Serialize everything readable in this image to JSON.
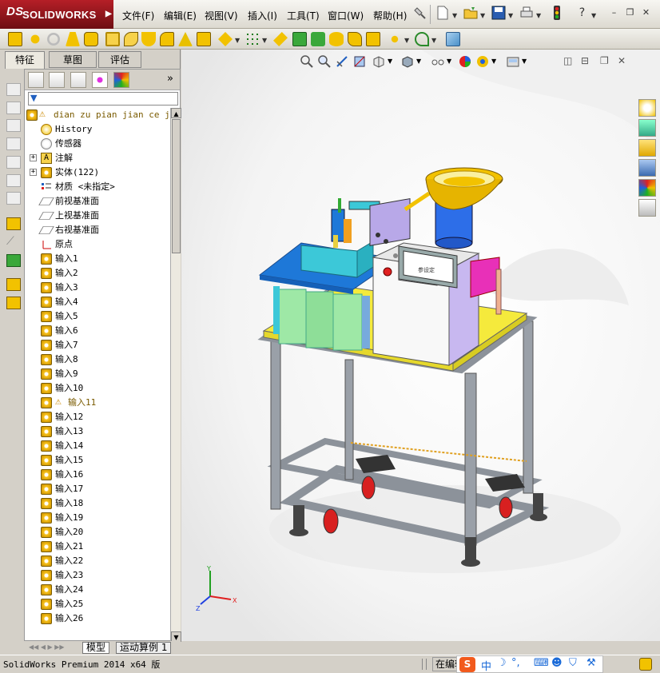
{
  "app": {
    "brand": "SOLIDWORKS",
    "brand_prefix": "DS",
    "status_text": "SolidWorks Premium 2014 x64 版",
    "status_mode": "在编辑"
  },
  "menu": [
    {
      "label": "文件(F)"
    },
    {
      "label": "编辑(E)"
    },
    {
      "label": "视图(V)"
    },
    {
      "label": "插入(I)"
    },
    {
      "label": "工具(T)"
    },
    {
      "label": "窗口(W)"
    },
    {
      "label": "帮助(H)"
    }
  ],
  "window_buttons": {
    "help": "?",
    "minimize": "–",
    "restore": "❐",
    "close": "✕"
  },
  "manager_tabs": [
    {
      "label": "特征",
      "active": true
    },
    {
      "label": "草图",
      "active": false
    },
    {
      "label": "评估",
      "active": false
    }
  ],
  "tree": {
    "root": "dian zu pian jian ce ji",
    "items": [
      {
        "label": "History",
        "icon": "history-icon"
      },
      {
        "label": "传感器",
        "icon": "sensor-icon"
      },
      {
        "label": "注解",
        "icon": "annotation-icon",
        "expandable": true
      },
      {
        "label": "实体(122)",
        "icon": "solid-bodies-icon",
        "expandable": true
      },
      {
        "label": "材质 <未指定>",
        "icon": "material-icon"
      },
      {
        "label": "前视基准面",
        "icon": "plane-icon"
      },
      {
        "label": "上视基准面",
        "icon": "plane-icon"
      },
      {
        "label": "右视基准面",
        "icon": "plane-icon"
      },
      {
        "label": "原点",
        "icon": "origin-icon"
      },
      {
        "label": "输入1",
        "icon": "imported-part-icon"
      },
      {
        "label": "输入2",
        "icon": "imported-part-icon"
      },
      {
        "label": "输入3",
        "icon": "imported-part-icon"
      },
      {
        "label": "输入4",
        "icon": "imported-part-icon"
      },
      {
        "label": "输入5",
        "icon": "imported-part-icon"
      },
      {
        "label": "输入6",
        "icon": "imported-part-icon"
      },
      {
        "label": "输入7",
        "icon": "imported-part-icon"
      },
      {
        "label": "输入8",
        "icon": "imported-part-icon"
      },
      {
        "label": "输入9",
        "icon": "imported-part-icon"
      },
      {
        "label": "输入10",
        "icon": "imported-part-icon"
      },
      {
        "label": "输入11",
        "icon": "imported-part-icon",
        "warning": true
      },
      {
        "label": "输入12",
        "icon": "imported-part-icon"
      },
      {
        "label": "输入13",
        "icon": "imported-part-icon"
      },
      {
        "label": "输入14",
        "icon": "imported-part-icon"
      },
      {
        "label": "输入15",
        "icon": "imported-part-icon"
      },
      {
        "label": "输入16",
        "icon": "imported-part-icon"
      },
      {
        "label": "输入17",
        "icon": "imported-part-icon"
      },
      {
        "label": "输入18",
        "icon": "imported-part-icon"
      },
      {
        "label": "输入19",
        "icon": "imported-part-icon"
      },
      {
        "label": "输入20",
        "icon": "imported-part-icon"
      },
      {
        "label": "输入21",
        "icon": "imported-part-icon"
      },
      {
        "label": "输入22",
        "icon": "imported-part-icon"
      },
      {
        "label": "输入23",
        "icon": "imported-part-icon"
      },
      {
        "label": "输入24",
        "icon": "imported-part-icon"
      },
      {
        "label": "输入25",
        "icon": "imported-part-icon"
      },
      {
        "label": "输入26",
        "icon": "imported-part-icon"
      }
    ]
  },
  "bottom_tabs": [
    {
      "label": "模型",
      "active": true
    },
    {
      "label": "运动算例 1",
      "active": false
    }
  ],
  "hmi_label": "参设定",
  "triad": {
    "x": "X",
    "y": "Y",
    "z": "Z"
  },
  "ime": {
    "label": "中",
    "icon": "sogou-ime-icon"
  },
  "colors": {
    "brand_red": "#a8161c",
    "machine_blue": "#1e78d8",
    "table_yellow": "#f5ea3c",
    "frame_gray": "#9aa0a8",
    "hopper_gold": "#f2c200",
    "bowl_blue": "#2d6ee8",
    "wheel_red": "#d82020",
    "panel_pink": "#e830b8"
  }
}
